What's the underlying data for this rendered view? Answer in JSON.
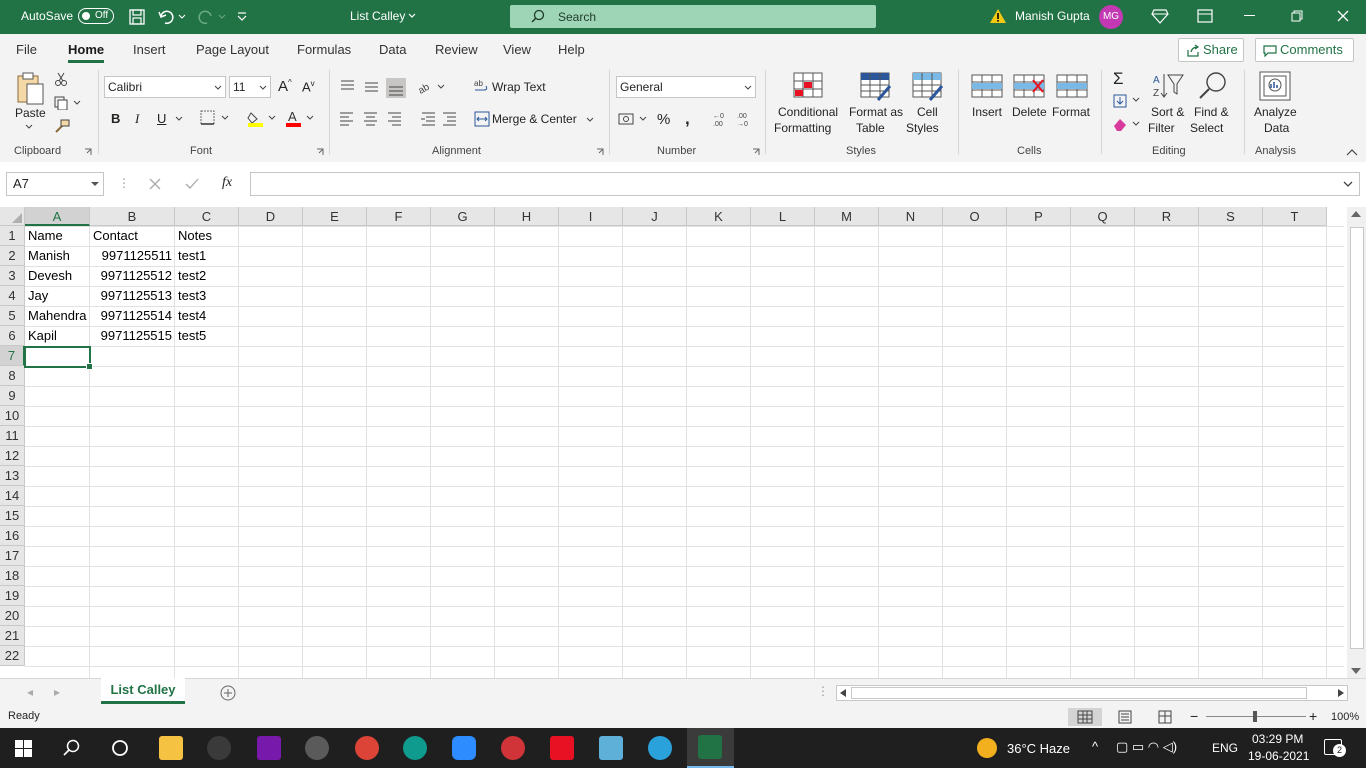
{
  "titlebar": {
    "autosave_label": "AutoSave",
    "autosave_state": "Off",
    "doc_title": "List Calley",
    "search_placeholder": "Search",
    "user_name": "Manish Gupta",
    "user_initials": "MG"
  },
  "menu": {
    "tabs": [
      "File",
      "Home",
      "Insert",
      "Page Layout",
      "Formulas",
      "Data",
      "Review",
      "View",
      "Help"
    ],
    "active": "Home",
    "share_label": "Share",
    "comments_label": "Comments"
  },
  "ribbon": {
    "clipboard": {
      "group_label": "Clipboard",
      "paste_label": "Paste"
    },
    "font": {
      "group_label": "Font",
      "font_name": "Calibri",
      "font_size": "11",
      "bold": "B",
      "italic": "I",
      "underline": "U"
    },
    "alignment": {
      "group_label": "Alignment",
      "wrap_text": "Wrap Text",
      "merge_center": "Merge & Center"
    },
    "number": {
      "group_label": "Number",
      "format": "General"
    },
    "styles": {
      "group_label": "Styles",
      "conditional_1": "Conditional",
      "conditional_2": "Formatting",
      "format_table_1": "Format as",
      "format_table_2": "Table",
      "cell_styles_1": "Cell",
      "cell_styles_2": "Styles"
    },
    "cells": {
      "group_label": "Cells",
      "insert": "Insert",
      "delete": "Delete",
      "format": "Format"
    },
    "editing": {
      "group_label": "Editing",
      "sort_1": "Sort &",
      "sort_2": "Filter",
      "find_1": "Find &",
      "find_2": "Select"
    },
    "analysis": {
      "group_label": "Analysis",
      "analyze_1": "Analyze",
      "analyze_2": "Data"
    }
  },
  "formula_bar": {
    "name_box": "A7",
    "fx": "fx",
    "content": ""
  },
  "sheet": {
    "columns": [
      "A",
      "B",
      "C",
      "D",
      "E",
      "F",
      "G",
      "H",
      "I",
      "J",
      "K",
      "L",
      "M",
      "N",
      "O",
      "P",
      "Q",
      "R",
      "S",
      "T"
    ],
    "rows": [
      "1",
      "2",
      "3",
      "4",
      "5",
      "6",
      "7",
      "8",
      "9",
      "10",
      "11",
      "12",
      "13",
      "14",
      "15",
      "16",
      "17",
      "18",
      "19",
      "20",
      "21",
      "22"
    ],
    "selected_cell": "A7",
    "data": [
      [
        "Name",
        "Contact",
        "Notes"
      ],
      [
        "Manish",
        "9971125511",
        "test1"
      ],
      [
        "Devesh",
        "9971125512",
        "test2"
      ],
      [
        "Jay",
        "9971125513",
        "test3"
      ],
      [
        "Mahendra",
        "9971125514",
        "test4"
      ],
      [
        "Kapil",
        "9971125515",
        "test5"
      ]
    ]
  },
  "sheet_tabs": {
    "active": "List Calley"
  },
  "status": {
    "ready": "Ready",
    "zoom": "100%"
  },
  "taskbar": {
    "weather": "36°C  Haze",
    "lang": "ENG",
    "time": "03:29 PM",
    "date": "19-06-2021",
    "notifications": "2"
  }
}
